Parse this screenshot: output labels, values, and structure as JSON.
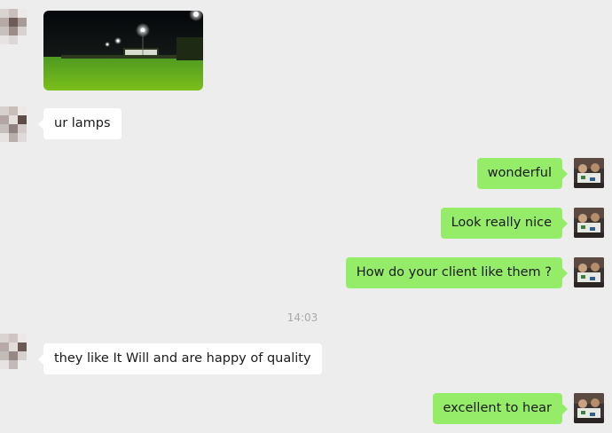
{
  "colors": {
    "background": "#ededed",
    "bubble_incoming": "#ffffff",
    "bubble_outgoing": "#95ec69"
  },
  "messages": [
    {
      "kind": "image",
      "side": "in",
      "content": "photo of a football field lit by floodlights at night"
    },
    {
      "kind": "text",
      "side": "in",
      "text": "ur lamps"
    },
    {
      "kind": "text",
      "side": "out",
      "text": "wonderful"
    },
    {
      "kind": "text",
      "side": "out",
      "text": "Look really nice"
    },
    {
      "kind": "text",
      "side": "out",
      "text": "How do your client like them ?"
    },
    {
      "kind": "timestamp",
      "text": "14:03"
    },
    {
      "kind": "text",
      "side": "in",
      "text": "they like It Will and are happy of quality"
    },
    {
      "kind": "text",
      "side": "out",
      "text": "excellent to hear"
    }
  ]
}
